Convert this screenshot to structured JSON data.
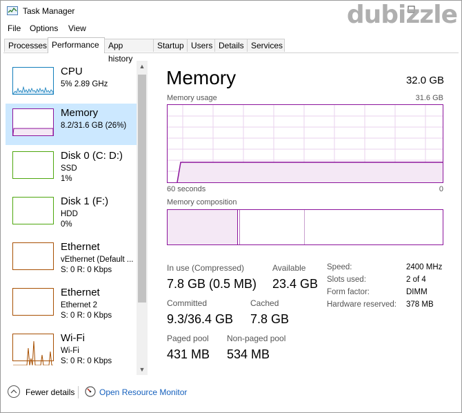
{
  "window": {
    "title": "Task Manager",
    "watermark": "dubizzle"
  },
  "menu": [
    "File",
    "Options",
    "View"
  ],
  "tabs": [
    "Processes",
    "Performance",
    "App history",
    "Startup",
    "Users",
    "Details",
    "Services"
  ],
  "sidebar": [
    {
      "name": "CPU",
      "line1": "5%  2.89 GHz",
      "line2": "",
      "line3": ""
    },
    {
      "name": "Memory",
      "line1": "8.2/31.6 GB (26%)",
      "line2": "",
      "line3": ""
    },
    {
      "name": "Disk 0 (C: D:)",
      "line1": "SSD",
      "line2": "1%",
      "line3": ""
    },
    {
      "name": "Disk 1 (F:)",
      "line1": "HDD",
      "line2": "0%",
      "line3": ""
    },
    {
      "name": "Ethernet",
      "line1": "vEthernet (Default ...",
      "line2": "S: 0  R: 0 Kbps",
      "line3": ""
    },
    {
      "name": "Ethernet",
      "line1": "Ethernet 2",
      "line2": "S: 0  R: 0 Kbps",
      "line3": ""
    },
    {
      "name": "Wi-Fi",
      "line1": "Wi-Fi",
      "line2": "S: 0  R: 0 Kbps",
      "line3": ""
    }
  ],
  "main": {
    "title": "Memory",
    "total": "32.0 GB",
    "usage_label": "Memory usage",
    "usage_max": "31.6 GB",
    "time_left": "60 seconds",
    "time_right": "0",
    "composition_label": "Memory composition",
    "usage_fraction": 0.26
  },
  "stats": {
    "in_use_label": "In use (Compressed)",
    "in_use": "7.8 GB (0.5 MB)",
    "available_label": "Available",
    "available": "23.4 GB",
    "committed_label": "Committed",
    "committed": "9.3/36.4 GB",
    "cached_label": "Cached",
    "cached": "7.8 GB",
    "paged_label": "Paged pool",
    "paged": "431 MB",
    "nonpaged_label": "Non-paged pool",
    "nonpaged": "534 MB"
  },
  "specs": [
    {
      "label": "Speed:",
      "value": "2400 MHz"
    },
    {
      "label": "Slots used:",
      "value": "2 of 4"
    },
    {
      "label": "Form factor:",
      "value": "DIMM"
    },
    {
      "label": "Hardware reserved:",
      "value": "378 MB"
    }
  ],
  "footer": {
    "fewer": "Fewer details",
    "resmon": "Open Resource Monitor"
  },
  "colors": {
    "memory": "#8b129b",
    "cpu": "#117dbb",
    "disk": "#4da60c",
    "ethernet": "#a74f01",
    "selected": "#cce8ff"
  }
}
